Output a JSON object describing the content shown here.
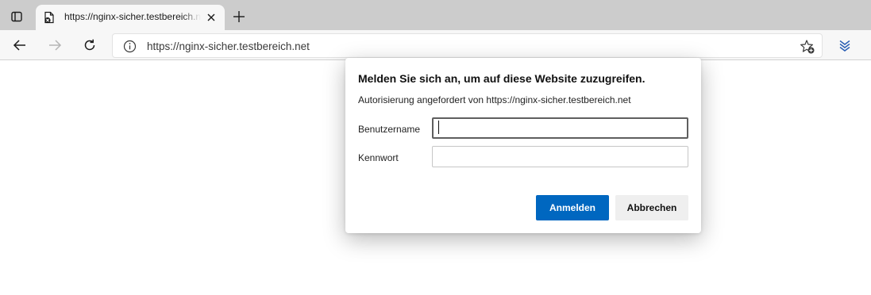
{
  "browser": {
    "tab": {
      "title": "https://nginx-sicher.testbereich.net"
    },
    "address_bar": {
      "url": "https://nginx-sicher.testbereich.net"
    },
    "icons": {
      "tab_actions": "tab-actions-icon",
      "favicon": "page-favicon-icon",
      "close": "close-icon",
      "new_tab": "plus-icon",
      "back": "back-arrow-icon",
      "forward": "forward-arrow-icon",
      "refresh": "refresh-icon",
      "site_info": "info-icon",
      "add_favorite": "star-add-icon",
      "collections": "collections-icon"
    }
  },
  "dialog": {
    "title": "Melden Sie sich an, um auf diese Website zuzugreifen.",
    "subtitle": "Autorisierung angefordert von https://nginx-sicher.testbereich.net",
    "username_label": "Benutzername",
    "username_value": "",
    "password_label": "Kennwort",
    "password_value": "",
    "submit_label": "Anmelden",
    "cancel_label": "Abbrechen"
  },
  "colors": {
    "primary_button": "#0067c0",
    "collections_icon": "#2b5fb4",
    "tabstrip_bg": "#cccccc",
    "toolbar_bg": "#f7f7f7"
  }
}
